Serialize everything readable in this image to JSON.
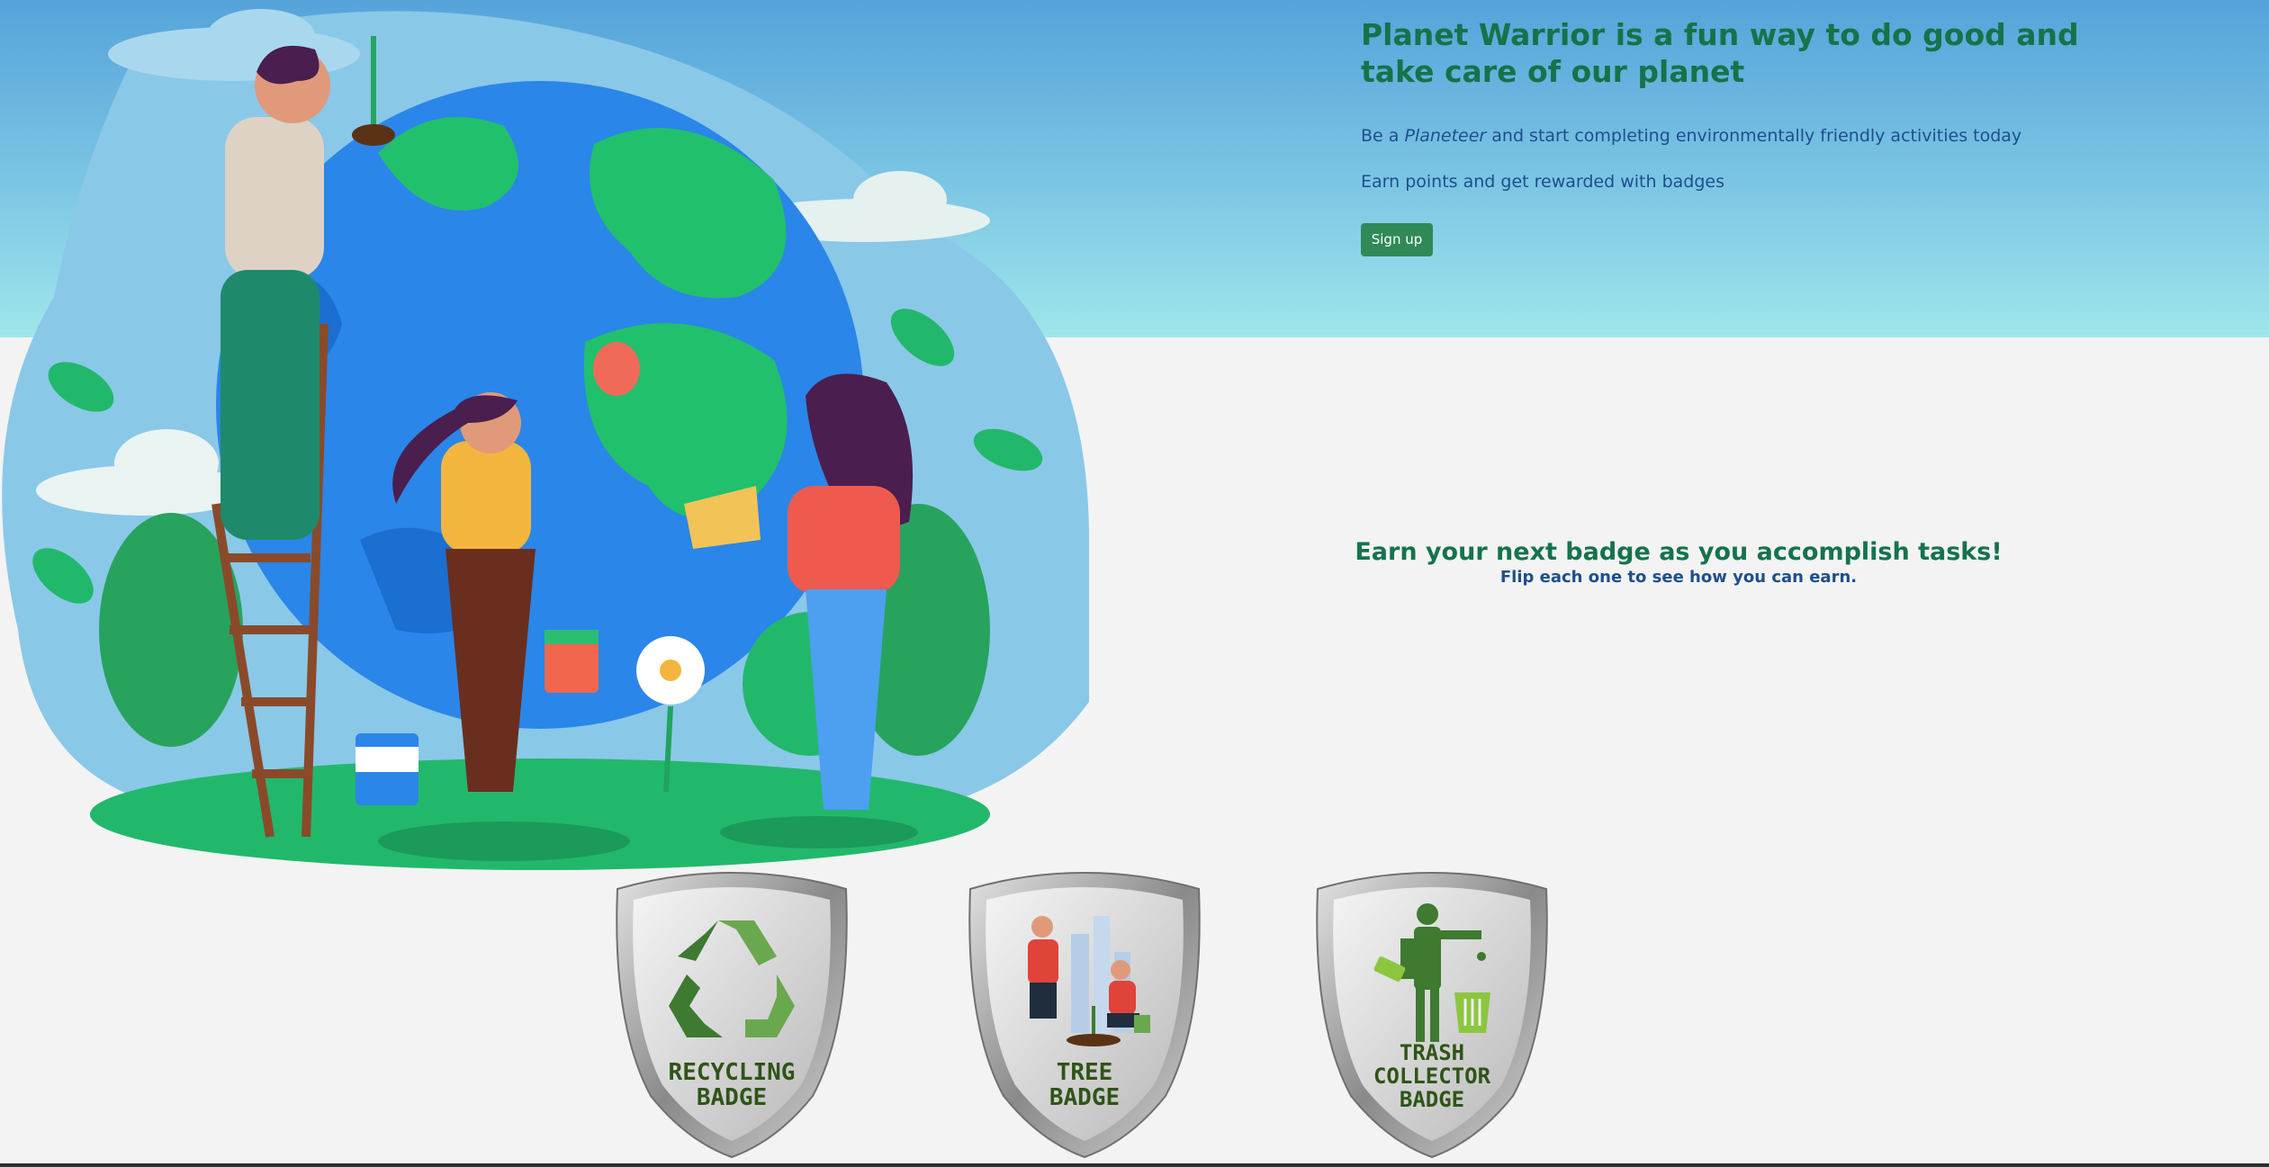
{
  "hero": {
    "title": "Planet Warrior is a fun way to do good and take care of our planet",
    "line1_before": "Be a ",
    "line1_emphasis": "Planeteer",
    "line1_after": " and start completing environmentally friendly activities today",
    "line2": "Earn points and get rewarded with badges",
    "signup_label": "Sign up"
  },
  "earn": {
    "title": "Earn your next badge as you accomplish tasks!",
    "subtitle": "Flip each one to see how you can earn."
  },
  "badges": [
    {
      "line1": "RECYCLING",
      "line2": "BADGE"
    },
    {
      "line1": "TREE",
      "line2": "BADGE"
    },
    {
      "line1": "TRASH",
      "line2": "COLLECTOR",
      "line3": "BADGE"
    }
  ],
  "colors": {
    "title_green": "#157349",
    "text_blue": "#1d4f8c",
    "button_green": "#2f8a58",
    "sky_top": "#55a3da",
    "sky_bottom": "#9fe6ea",
    "page_bg": "#f3f3f3"
  }
}
